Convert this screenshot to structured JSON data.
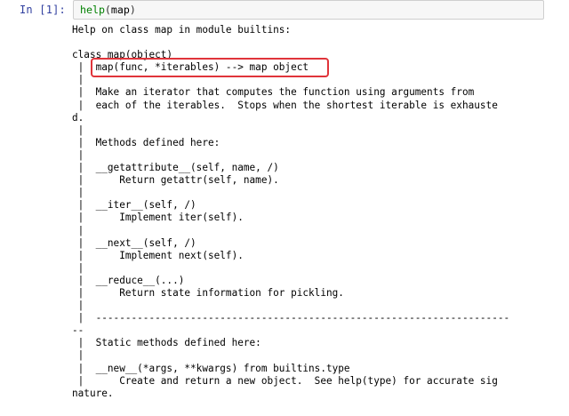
{
  "cell": {
    "prompt": "In [1]:",
    "code_fn": "help",
    "code_open": "(",
    "code_arg": "map",
    "code_close": ")"
  },
  "output": {
    "lines": [
      "Help on class map in module builtins:",
      "",
      "class map(object)",
      " |  map(func, *iterables) --> map object",
      " |",
      " |  Make an iterator that computes the function using arguments from",
      " |  each of the iterables.  Stops when the shortest iterable is exhauste",
      "d.",
      " |",
      " |  Methods defined here:",
      " |",
      " |  __getattribute__(self, name, /)",
      " |      Return getattr(self, name).",
      " |",
      " |  __iter__(self, /)",
      " |      Implement iter(self).",
      " |",
      " |  __next__(self, /)",
      " |      Implement next(self).",
      " |",
      " |  __reduce__(...)",
      " |      Return state information for pickling.",
      " |",
      " |  ----------------------------------------------------------------------",
      "--",
      " |  Static methods defined here:",
      " |",
      " |  __new__(*args, **kwargs) from builtins.type",
      " |      Create and return a new object.  See help(type) for accurate sig",
      "nature."
    ]
  },
  "colors": {
    "prompt": "#303f9f",
    "highlight_border": "#e0343a",
    "input_bg": "#f7f7f7"
  }
}
